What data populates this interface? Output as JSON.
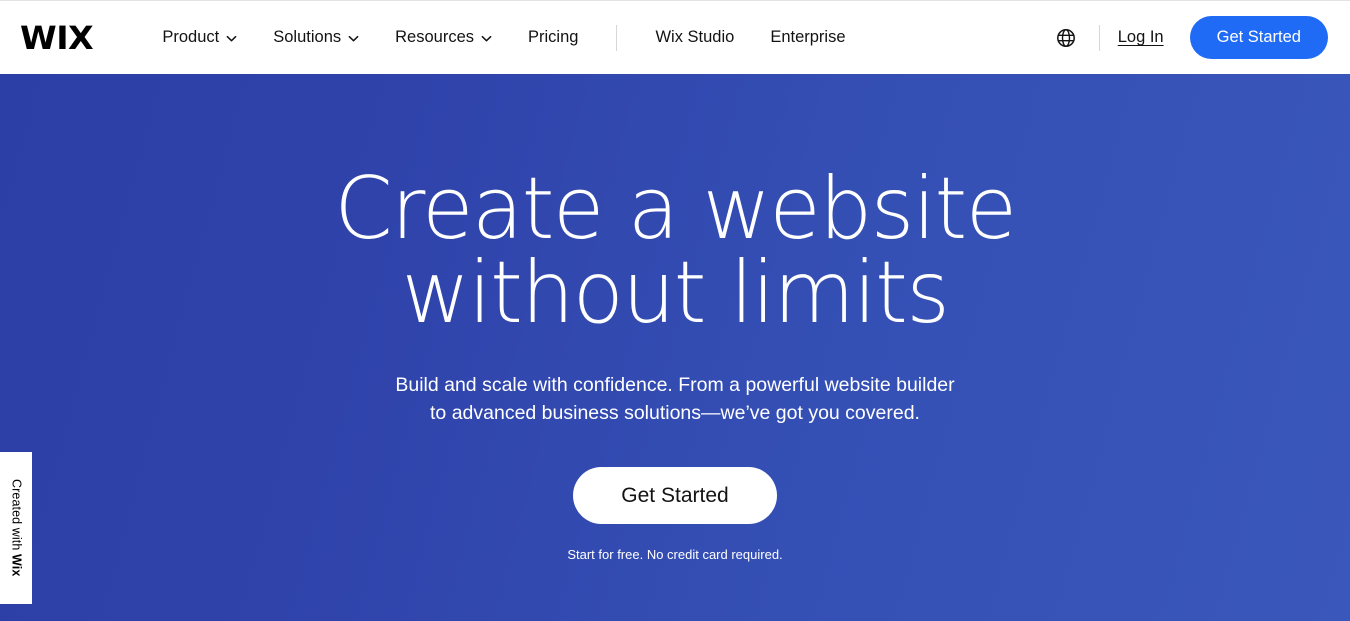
{
  "header": {
    "logo_text": "WIX",
    "nav_items": [
      {
        "label": "Product",
        "has_chevron": true,
        "icon": "chevron-down-icon"
      },
      {
        "label": "Solutions",
        "has_chevron": true,
        "icon": "chevron-down-icon"
      },
      {
        "label": "Resources",
        "has_chevron": true,
        "icon": "chevron-down-icon"
      },
      {
        "label": "Pricing",
        "has_chevron": false,
        "icon": ""
      }
    ],
    "nav_items_secondary": [
      {
        "label": "Wix Studio"
      },
      {
        "label": "Enterprise"
      }
    ],
    "language_icon": "globe-icon",
    "login_label": "Log In",
    "get_started_label": "Get Started",
    "colors": {
      "cta_blue": "#1f6bf5",
      "text": "#131313",
      "divider": "#d6d6d6",
      "background": "#ffffff"
    }
  },
  "hero": {
    "title_line1": "Create a website",
    "title_line2": "without limits",
    "subtitle_line1": "Build and scale with confidence. From a powerful website builder",
    "subtitle_line2": "to advanced business solutions—we’ve got you covered.",
    "cta_label": "Get Started",
    "note": "Start for free. No credit card required.",
    "colors": {
      "gradient_start": "#2b3fa7",
      "gradient_end": "#3a57bb",
      "text": "#ffffff",
      "cta_background": "#ffffff",
      "cta_text": "#131313"
    }
  },
  "badge": {
    "prefix": "Created with ",
    "brand": "Wix",
    "background": "#ffffff",
    "text_color": "#000000"
  }
}
